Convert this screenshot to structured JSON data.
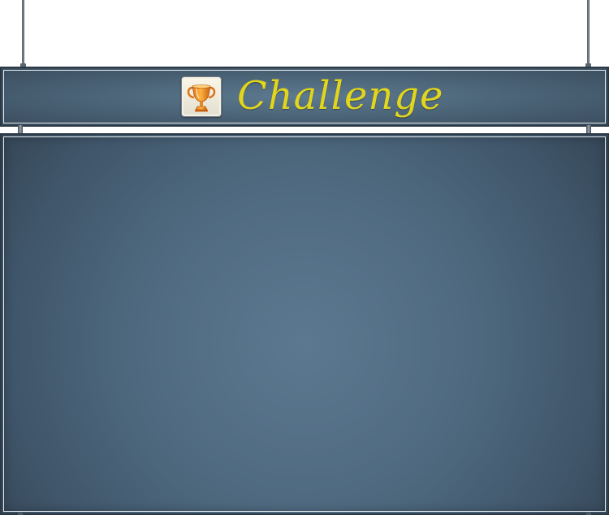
{
  "title": {
    "text": "Challenge",
    "icon": "trophy-icon",
    "text_color": "#e2d61c"
  },
  "colors": {
    "panel_center": "#5c7890",
    "panel_edge": "#364859",
    "frame_border": "#2c3945",
    "frame_highlight": "#e6edf2"
  },
  "content": {
    "items": []
  }
}
